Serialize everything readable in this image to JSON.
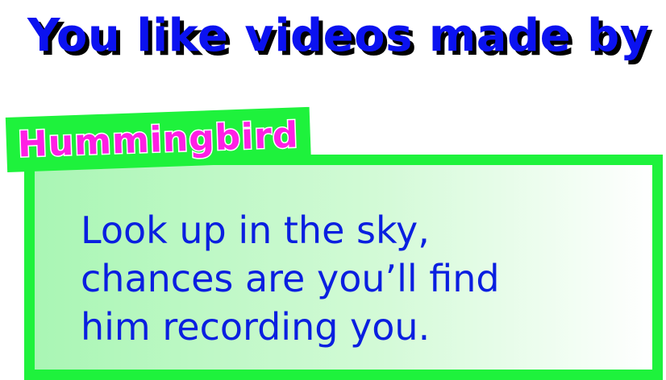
{
  "headline": "You like videos made by",
  "creator_name": "Hummingbird",
  "description": "Look up in the sky,\nchances are you’ll find\nhim recording you.",
  "colors": {
    "headline_text": "#0b12f0",
    "badge_background": "#1ef23c",
    "badge_text": "#ff1fe4",
    "card_border": "#1ef23c",
    "description_text": "#0a1fe0"
  }
}
